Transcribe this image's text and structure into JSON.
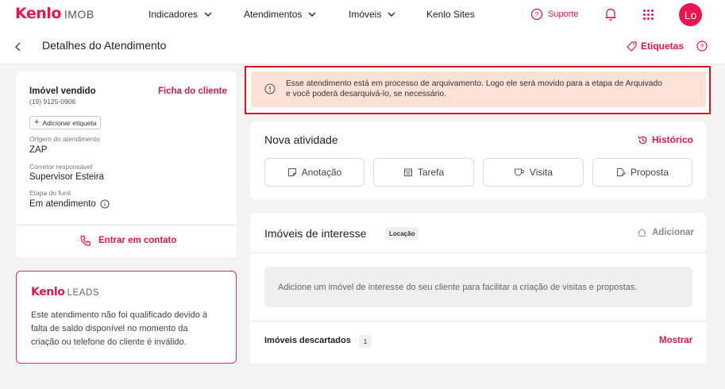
{
  "header": {
    "logo": "Kenlo",
    "logo_suffix": "IMOB",
    "nav": [
      {
        "label": "Indicadores"
      },
      {
        "label": "Atendimentos"
      },
      {
        "label": "Imóveis"
      },
      {
        "label": "Kenlo Sites"
      }
    ],
    "support_label": "Suporte",
    "avatar_initials": "Lo"
  },
  "subheader": {
    "title": "Detalhes do Atendimento",
    "tags_label": "Etiquetas"
  },
  "alert": {
    "line1": "Esse atendimento está em processo de arquivamento. Logo ele será movido para a etapa de Arquivado",
    "line2": "e você poderá desarquivá-lo, se necessário."
  },
  "client": {
    "status": "Imóvel vendido",
    "phone": "(19) 9125-0906",
    "ficha_link": "Ficha do cliente",
    "add_tag_label": "Adicionar etiqueta",
    "origin_label": "Origem do atendimento",
    "origin_value": "ZAP",
    "broker_label": "Corretor responsável",
    "broker_value": "Supervisor Esteira",
    "stage_label": "Etapa do funil",
    "stage_value": "Em atendimento",
    "contact_label": "Entrar em contato"
  },
  "leads": {
    "logo": "Kenlo",
    "logo_suffix": "LEADS",
    "line1": "Este atendimento não foi qualificado devido à",
    "line2": "falta de saldo disponível no momento da",
    "line3": "criação ou telefone do cliente é inválido."
  },
  "activity": {
    "title": "Nova atividade",
    "history_label": "Histórico",
    "buttons": [
      {
        "label": "Anotação",
        "icon": "note-icon"
      },
      {
        "label": "Tarefa",
        "icon": "calendar-icon"
      },
      {
        "label": "Visita",
        "icon": "coffee-icon"
      },
      {
        "label": "Proposta",
        "icon": "document-edit-icon"
      }
    ]
  },
  "interest": {
    "title": "Imóveis de interesse",
    "badge": "Locação",
    "add_label": "Adicionar",
    "empty_text": "Adicione um imóvel de interesse do seu cliente para facilitar a criação de visitas e propostas.",
    "discarded_label": "Imóveis descartados",
    "discarded_count": "1",
    "show_label": "Mostrar"
  },
  "colors": {
    "brand": "#e8154f",
    "alert_bg": "#fbe1d6",
    "highlight_border": "#e0141e"
  }
}
